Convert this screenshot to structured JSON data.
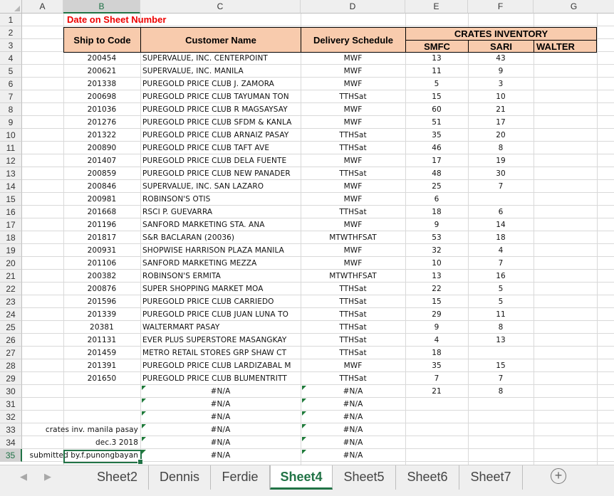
{
  "columns": [
    "A",
    "B",
    "C",
    "D",
    "E",
    "F",
    "G"
  ],
  "selected_column": "B",
  "selected_row": 35,
  "header": {
    "title": "Date on Sheet Number",
    "ship_to_code": "Ship to Code",
    "customer_name": "Customer Name",
    "delivery_schedule": "Delivery Schedule",
    "crates_inventory": "CRATES INVENTORY",
    "smfc": "SMFC",
    "sari": "SARI",
    "walter": "WALTER"
  },
  "rows": [
    {
      "code": "200454",
      "name": "SUPERVALUE, INC. CENTERPOINT",
      "sched": "MWF",
      "smfc": "13",
      "sari": "43"
    },
    {
      "code": "200621",
      "name": "SUPERVALUE, INC. MANILA",
      "sched": "MWF",
      "smfc": "11",
      "sari": "9"
    },
    {
      "code": "201338",
      "name": "PUREGOLD PRICE CLUB J. ZAMORA",
      "sched": "MWF",
      "smfc": "5",
      "sari": "3"
    },
    {
      "code": "200698",
      "name": "PUREGOLD PRICE CLUB TAYUMAN TON",
      "sched": "TTHSat",
      "smfc": "15",
      "sari": "10"
    },
    {
      "code": "201036",
      "name": "PUREGOLD PRICE CLUB R MAGSAYSAY",
      "sched": "MWF",
      "smfc": "60",
      "sari": "21"
    },
    {
      "code": "201276",
      "name": "PUREGOLD PRICE CLUB SFDM & KANLA",
      "sched": "MWF",
      "smfc": "51",
      "sari": "17"
    },
    {
      "code": "201322",
      "name": "PUREGOLD PRICE CLUB ARNAIZ PASAY",
      "sched": "TTHSat",
      "smfc": "35",
      "sari": "20"
    },
    {
      "code": "200890",
      "name": "PUREGOLD PRICE CLUB TAFT AVE",
      "sched": "TTHSat",
      "smfc": "46",
      "sari": "8"
    },
    {
      "code": "201407",
      "name": "PUREGOLD PRICE CLUB DELA FUENTE",
      "sched": "MWF",
      "smfc": "17",
      "sari": "19"
    },
    {
      "code": "200859",
      "name": "PUREGOLD PRICE CLUB NEW PANADER",
      "sched": "TTHSat",
      "smfc": "48",
      "sari": "30"
    },
    {
      "code": "200846",
      "name": "SUPERVALUE, INC. SAN LAZARO",
      "sched": "MWF",
      "smfc": "25",
      "sari": "7"
    },
    {
      "code": "200981",
      "name": "ROBINSON'S OTIS",
      "sched": "MWF",
      "smfc": "6",
      "sari": ""
    },
    {
      "code": "201668",
      "name": "RSCI P. GUEVARRA",
      "sched": "TTHSat",
      "smfc": "18",
      "sari": "6"
    },
    {
      "code": "201196",
      "name": "SANFORD MARKETING STA. ANA",
      "sched": "MWF",
      "smfc": "9",
      "sari": "14"
    },
    {
      "code": "201817",
      "name": "S&R BACLARAN (20036)",
      "sched": "MTWTHFSAT",
      "smfc": "53",
      "sari": "18"
    },
    {
      "code": "200931",
      "name": "SHOPWISE HARRISON PLAZA MANILA",
      "sched": "MWF",
      "smfc": "32",
      "sari": "4"
    },
    {
      "code": "201106",
      "name": "SANFORD MARKETING MEZZA",
      "sched": "MWF",
      "smfc": "10",
      "sari": "7"
    },
    {
      "code": "200382",
      "name": "ROBINSON'S ERMITA",
      "sched": "MTWTHFSAT",
      "smfc": "13",
      "sari": "16"
    },
    {
      "code": "200876",
      "name": "SUPER SHOPPING MARKET MOA",
      "sched": "TTHSat",
      "smfc": "22",
      "sari": "5"
    },
    {
      "code": "201596",
      "name": "PUREGOLD PRICE CLUB CARRIEDO",
      "sched": "TTHSat",
      "smfc": "15",
      "sari": "5"
    },
    {
      "code": "201339",
      "name": "PUREGOLD PRICE CLUB JUAN LUNA TO",
      "sched": "TTHSat",
      "smfc": "29",
      "sari": "11"
    },
    {
      "code": "20381",
      "name": "WALTERMART PASAY",
      "sched": "TTHSat",
      "smfc": "9",
      "sari": "8"
    },
    {
      "code": "201131",
      "name": "EVER PLUS SUPERSTORE MASANGKAY",
      "sched": "TTHSat",
      "smfc": "4",
      "sari": "13"
    },
    {
      "code": "201459",
      "name": "METRO RETAIL STORES GRP SHAW CT",
      "sched": "TTHSat",
      "smfc": "18",
      "sari": ""
    },
    {
      "code": "201391",
      "name": "PUREGOLD PRICE CLUB LARDIZABAL M",
      "sched": "MWF",
      "smfc": "35",
      "sari": "15"
    },
    {
      "code": "201650",
      "name": "PUREGOLD PRICE CLUB BLUMENTRITT",
      "sched": "TTHSat",
      "smfc": "7",
      "sari": "7"
    },
    {
      "code": "",
      "name": "#N/A",
      "sched": "#N/A",
      "smfc": "21",
      "sari": "8"
    },
    {
      "code": "",
      "name": "#N/A",
      "sched": "#N/A",
      "smfc": "",
      "sari": ""
    },
    {
      "code": "",
      "name": "#N/A",
      "sched": "#N/A",
      "smfc": "",
      "sari": ""
    },
    {
      "code": "crates inv. manila pasay",
      "name": "#N/A",
      "sched": "#N/A",
      "smfc": "",
      "sari": ""
    },
    {
      "code": "dec.3 2018",
      "name": "#N/A",
      "sched": "#N/A",
      "smfc": "",
      "sari": ""
    },
    {
      "code": "submitted by.f.punongbayan",
      "name": "#N/A",
      "sched": "#N/A",
      "smfc": "",
      "sari": ""
    }
  ],
  "sheet_tabs": [
    "Sheet2",
    "Dennis",
    "Ferdie",
    "Sheet4",
    "Sheet5",
    "Sheet6",
    "Sheet7"
  ],
  "active_tab": "Sheet4",
  "icons": {
    "prev": "triangle-left",
    "next": "triangle-right",
    "add": "plus-circle"
  }
}
